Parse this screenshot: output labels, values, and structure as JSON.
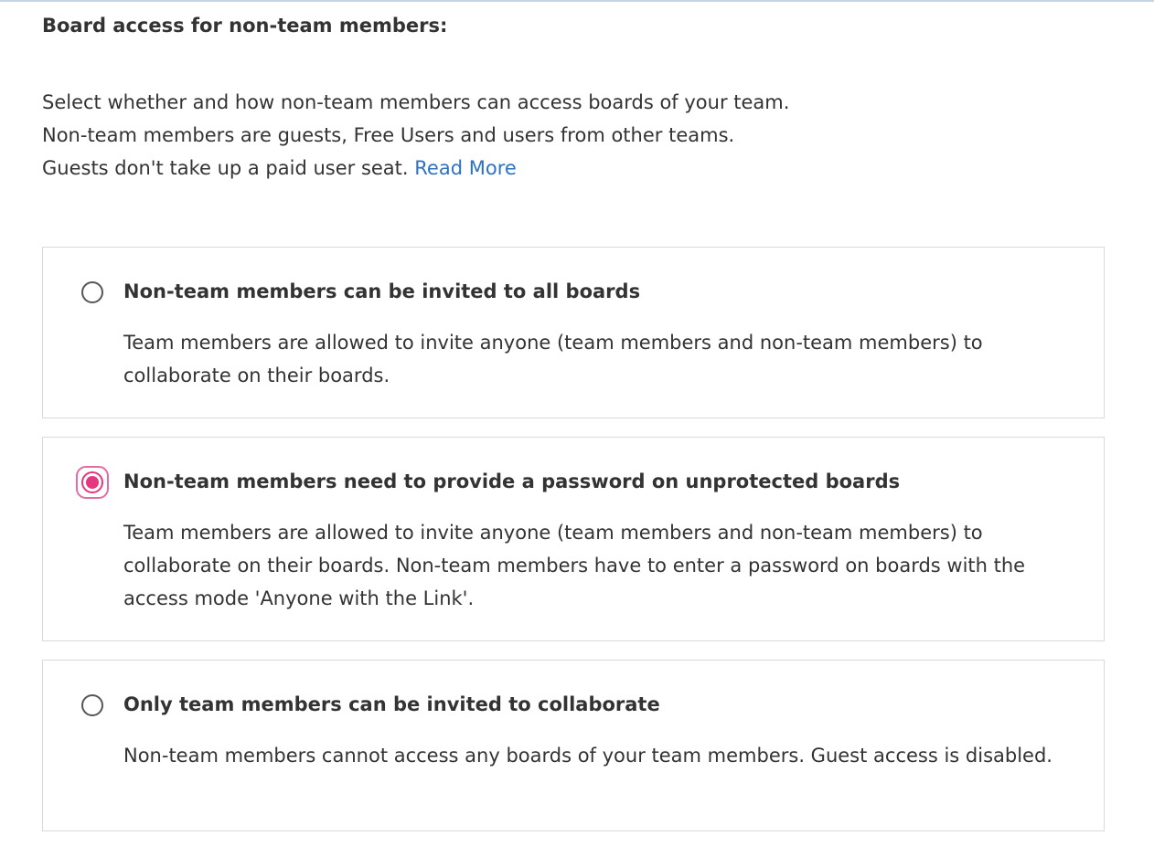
{
  "section": {
    "heading": "Board access for non-team members:",
    "intro_lines": [
      "Select whether and how non-team members can access boards of your team.",
      "Non-team members are guests, Free Users and users from other teams.",
      "Guests don't take up a paid user seat."
    ],
    "read_more_label": "Read More"
  },
  "options": [
    {
      "title": "Non-team members can be invited to all boards",
      "description": "Team members are allowed to invite anyone (team members and non-team members) to collaborate on their boards.",
      "selected": false
    },
    {
      "title": "Non-team members need to provide a password on unprotected boards",
      "description": "Team members are allowed to invite anyone (team members and non-team members) to collaborate on their boards. Non-team members have to enter a password on boards with the access mode 'Anyone with the Link'.",
      "selected": true
    },
    {
      "title": "Only team members can be invited to collaborate",
      "description": "Non-team members cannot access any boards of your team members. Guest access is disabled.",
      "selected": false
    }
  ],
  "colors": {
    "link": "#2d72c2",
    "selected_accent": "#e5377f",
    "border": "#d9d9d9",
    "text": "#333333"
  }
}
